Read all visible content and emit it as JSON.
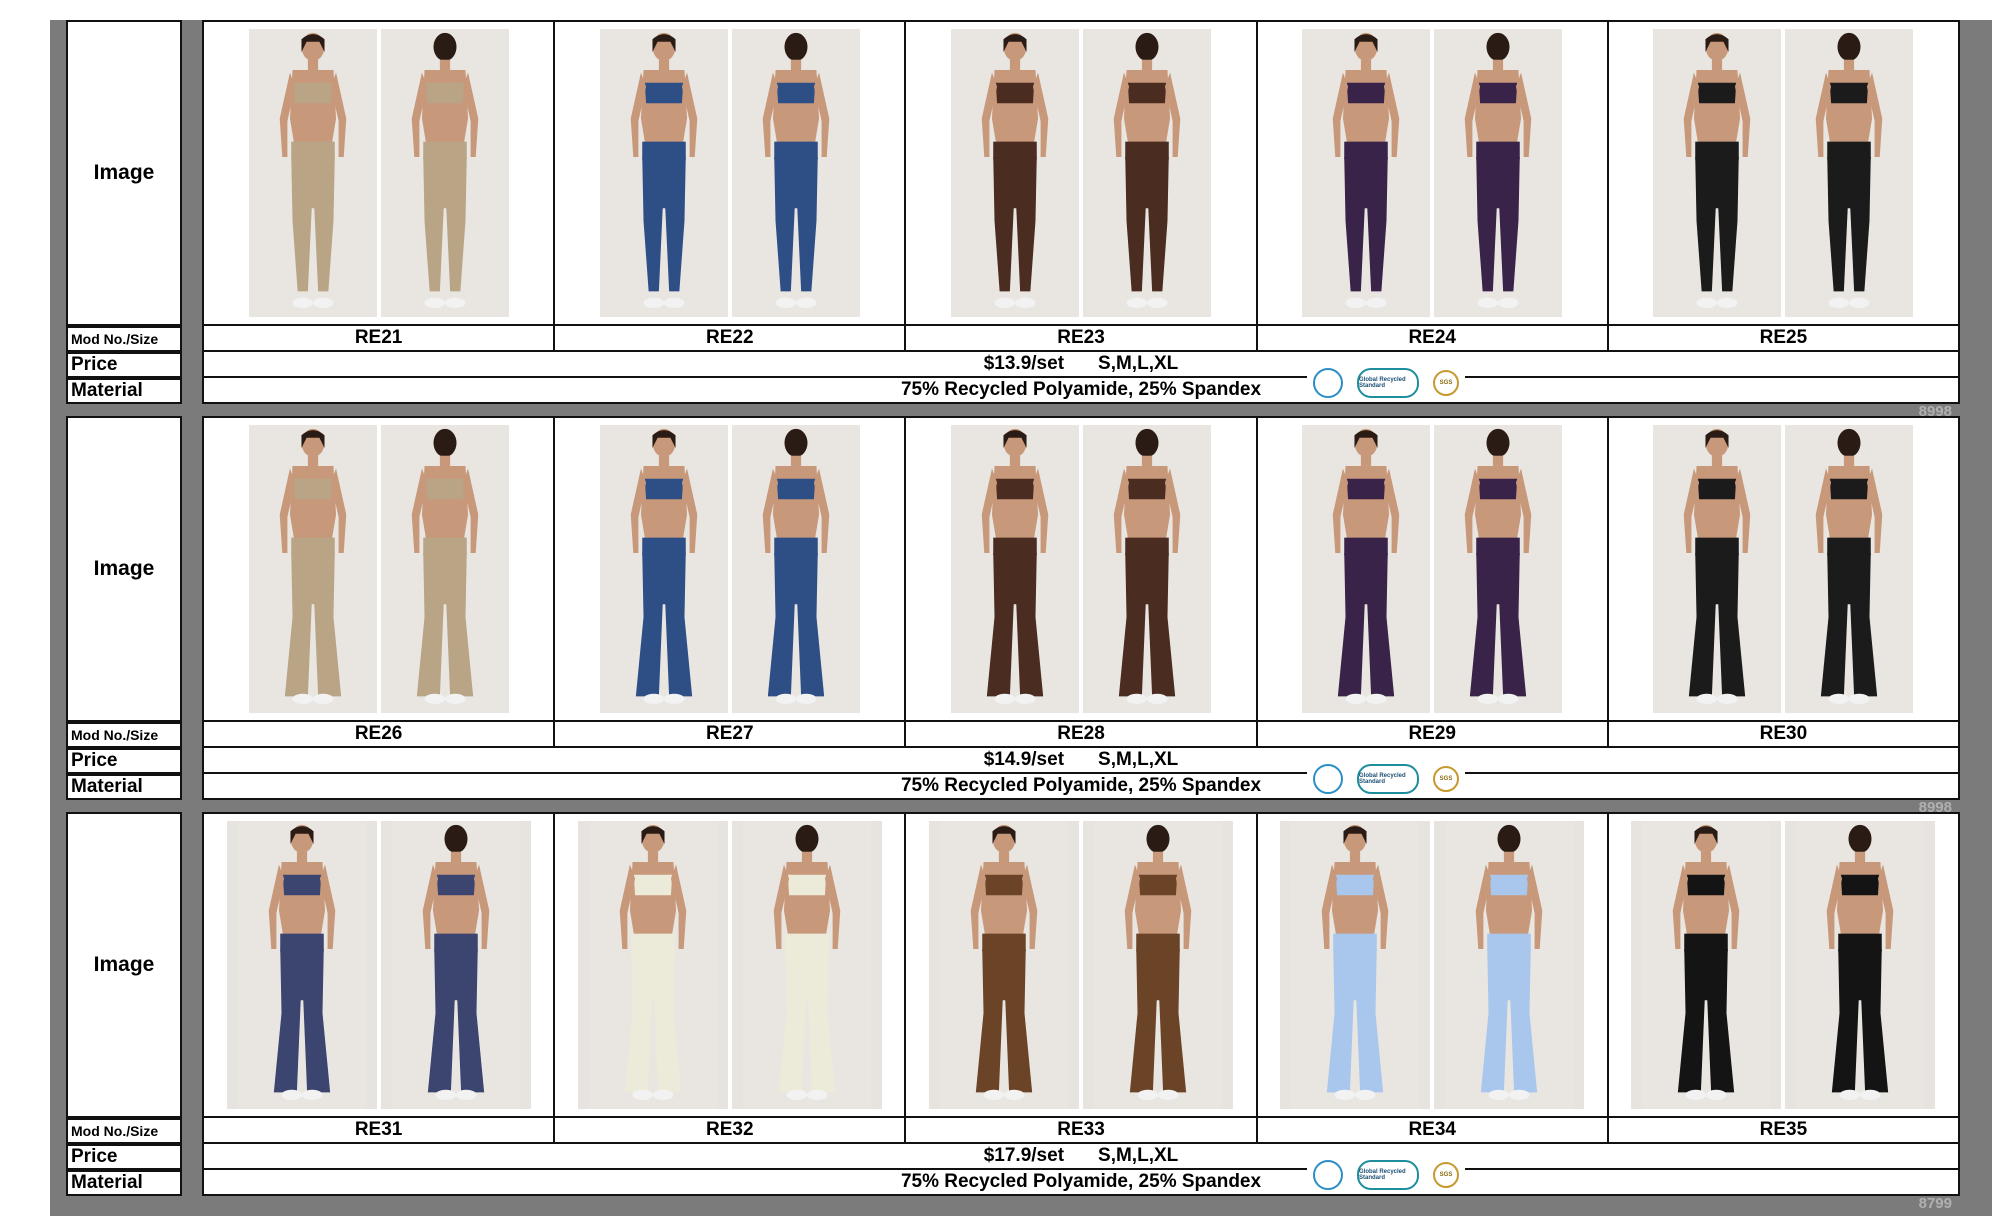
{
  "labels": {
    "image": "Image",
    "mod": "Mod No./Size",
    "price": "Price",
    "material": "Material"
  },
  "blocks": [
    {
      "models": [
        "RE21",
        "RE22",
        "RE23",
        "RE24",
        "RE25"
      ],
      "price": "$13.9/set",
      "sizes": "S,M,L,XL",
      "material": "75% Recycled Polyamide, 25% Spandex",
      "watermark": "8998",
      "style": "leggings",
      "colors": [
        "#b9a585",
        "#2e4f86",
        "#4a2c20",
        "#3a2348",
        "#1b1b1b"
      ]
    },
    {
      "models": [
        "RE26",
        "RE27",
        "RE28",
        "RE29",
        "RE30"
      ],
      "price": "$14.9/set",
      "sizes": "S,M,L,XL",
      "material": "75% Recycled Polyamide, 25% Spandex",
      "watermark": "8998",
      "style": "flare",
      "colors": [
        "#b9a585",
        "#2e4f86",
        "#4a2c20",
        "#3a2348",
        "#1b1b1b"
      ]
    },
    {
      "models": [
        "RE31",
        "RE32",
        "RE33",
        "RE34",
        "RE35"
      ],
      "price": "$17.9/set",
      "sizes": "S,M,L,XL",
      "material": "75% Recycled Polyamide, 25% Spandex",
      "watermark": "8799",
      "style": "flare-wide",
      "colors": [
        "#3c4470",
        "#ecead8",
        "#6b4326",
        "#a9c7ec",
        "#141414"
      ]
    }
  ],
  "certs": {
    "grs_text": "Global Recycled Standard",
    "sgs_text": "SGS"
  }
}
